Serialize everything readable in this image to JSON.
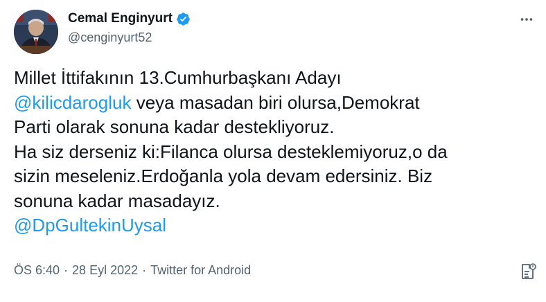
{
  "author": {
    "display_name": "Cemal Enginyurt",
    "handle": "@cenginyurt52",
    "verified": true,
    "verified_color": "#1d9bf0",
    "avatar_icon": "profile-photo"
  },
  "tweet": {
    "lines": [
      [
        {
          "text": "Millet İttifakının 13.Cumhurbaşkanı Adayı",
          "mention": false
        }
      ],
      [
        {
          "text": "@kilicdarogluk",
          "mention": true
        },
        {
          "text": " veya masadan biri olursa,Demokrat",
          "mention": false
        }
      ],
      [
        {
          "text": "Parti olarak sonuna kadar destekliyoruz.",
          "mention": false
        }
      ],
      [
        {
          "text": "Ha siz derseniz ki:Filanca olursa desteklemiyoruz,o da",
          "mention": false
        }
      ],
      [
        {
          "text": "sizin meseleniz.Erdoğanla yola devam edersiniz. Biz",
          "mention": false
        }
      ],
      [
        {
          "text": "sonuna kadar masadayız.",
          "mention": false
        }
      ],
      [
        {
          "text": "@DpGultekinUysal",
          "mention": true
        }
      ]
    ],
    "mention_color": "#1d9bf0"
  },
  "meta": {
    "time": "ÖS 6:40",
    "separator": "·",
    "date": "28 Eyl 2022",
    "source": "Twitter for Android"
  },
  "icons": {
    "more": "more-dots-icon",
    "analytics": "analytics-icon"
  },
  "colors": {
    "text": "#0f1419",
    "secondary": "#536471",
    "accent": "#1d9bf0"
  }
}
